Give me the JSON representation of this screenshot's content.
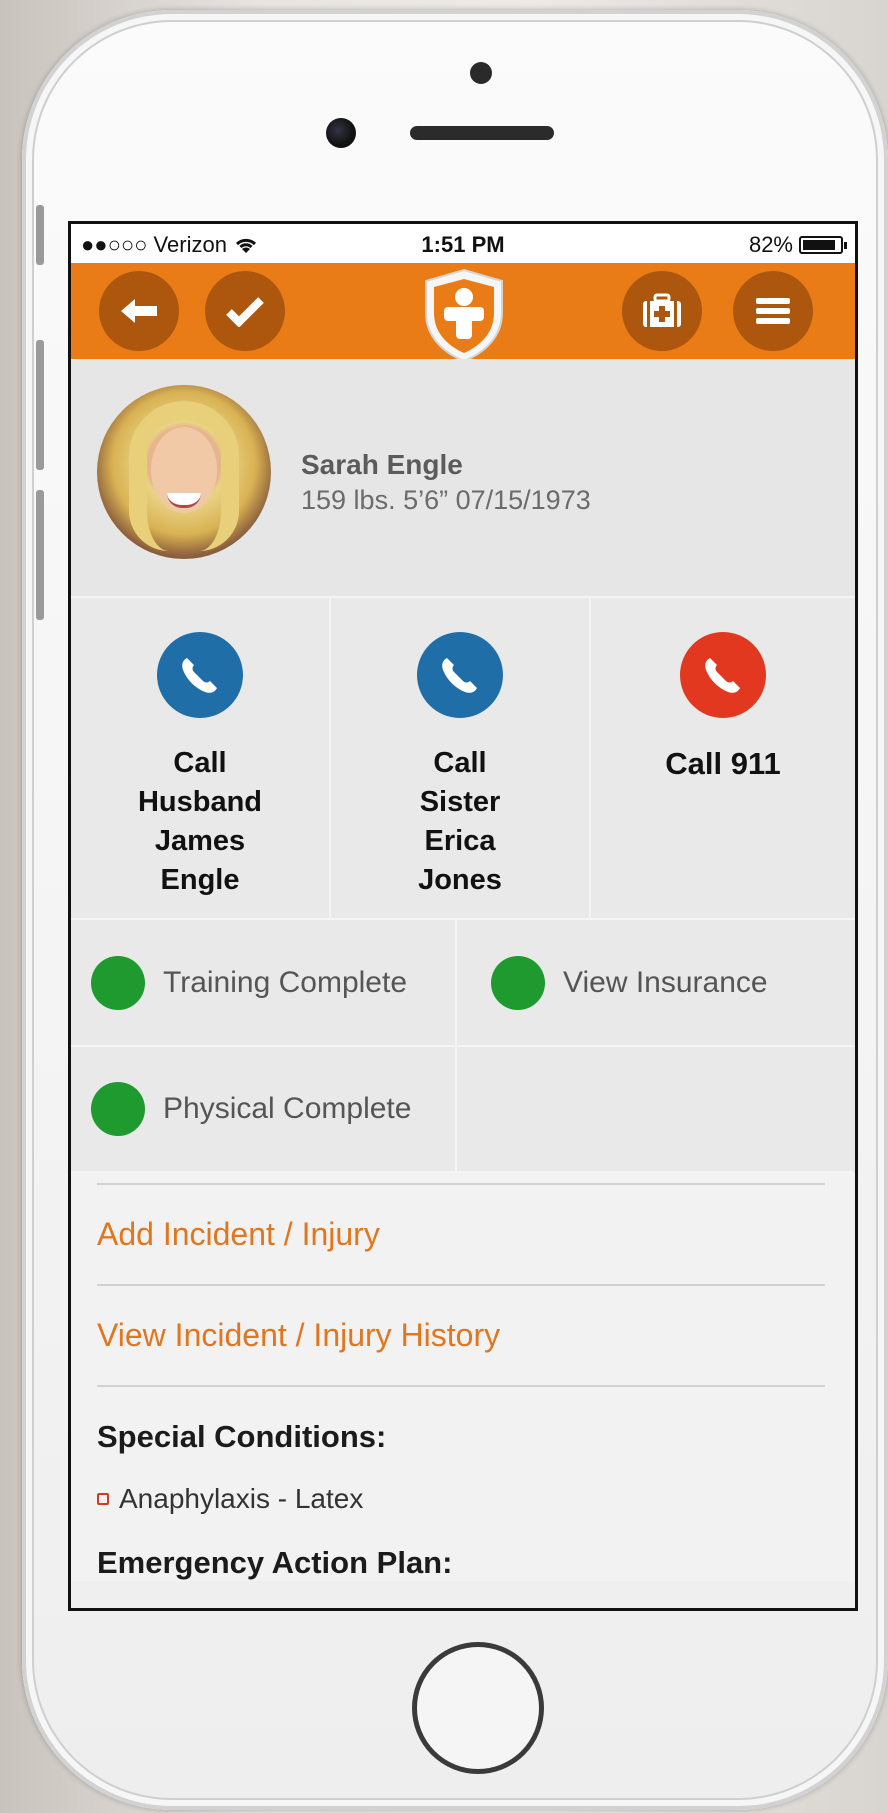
{
  "status_bar": {
    "carrier": "●●○○○ Verizon",
    "time": "1:51 PM",
    "battery": "82%"
  },
  "toolbar": {
    "back_icon": "arrow-left-icon",
    "check_icon": "checkmark-icon",
    "logo_icon": "shield-person-logo",
    "medkit_icon": "first-aid-kit-icon",
    "menu_icon": "hamburger-menu-icon",
    "accent_color": "#ea7c17",
    "button_color": "#ad560d"
  },
  "profile": {
    "name": "Sarah Engle",
    "details": "159 lbs. 5’6” 07/15/1973"
  },
  "calls": [
    {
      "lines": [
        "Call",
        "Husband",
        "James",
        "Engle"
      ],
      "color": "#1f6ea8"
    },
    {
      "lines": [
        "Call",
        "Sister",
        "Erica",
        "Jones"
      ],
      "color": "#1f6ea8"
    },
    {
      "lines": [
        "Call 911"
      ],
      "color": "#e2381f"
    }
  ],
  "status_items": [
    {
      "label": "Training Complete",
      "color": "#1f9a2e"
    },
    {
      "label": "View Insurance",
      "color": "#1f9a2e"
    },
    {
      "label": "Physical Complete",
      "color": "#1f9a2e"
    }
  ],
  "links": {
    "add_incident": "Add Incident / Injury",
    "view_history": "View Incident / Injury History"
  },
  "special_conditions": {
    "heading": "Special Conditions:",
    "items": [
      "Anaphylaxis - Latex"
    ]
  },
  "emergency_plan": {
    "heading": "Emergency Action Plan:"
  }
}
